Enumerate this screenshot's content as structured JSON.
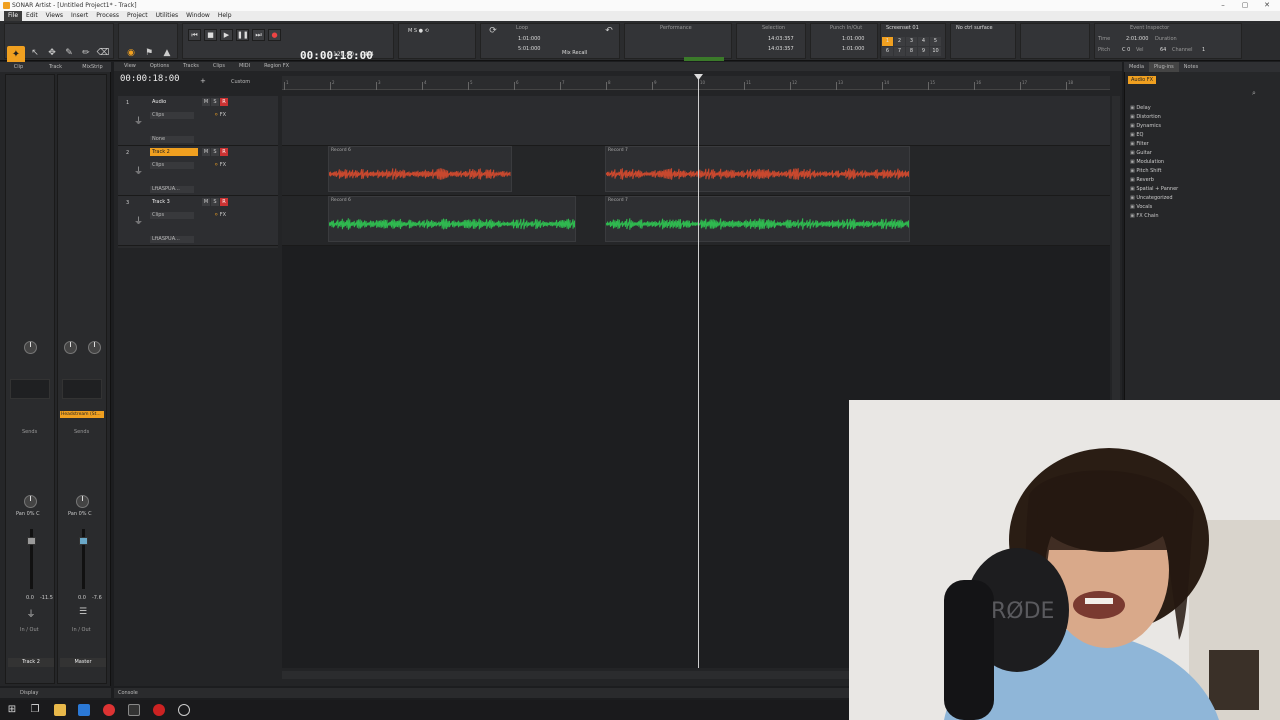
{
  "window": {
    "title": "SONAR Artist - [Untitled Project1* - Track]"
  },
  "menu": [
    "File",
    "Edit",
    "Views",
    "Insert",
    "Process",
    "Project",
    "Utilities",
    "Window",
    "Help"
  ],
  "control_bar": {
    "time": "00:00:18:00",
    "tempo": "120.00",
    "meter": "4/4",
    "loop_label": "Loop",
    "loop_start": "1:01:000",
    "loop_end": "5:01:000",
    "mix_recall": "Mix Recall",
    "performance_label": "Performance",
    "selection_label": "Selection",
    "selection_start": "14:03:357",
    "selection_end": "14:03:357",
    "punch_label": "Punch In/Out",
    "punch_start": "1:01:000",
    "punch_end": "1:01:000",
    "screenset_label": "Screenset 01",
    "screenset_nums": [
      "1",
      "2",
      "3",
      "4",
      "5",
      "6",
      "7",
      "8",
      "9",
      "10"
    ],
    "ctrl_surface": "No ctrl surface",
    "event_inspector": "Event Inspector",
    "ei_time": "Time",
    "ei_time_val": "2:01:000",
    "ei_duration": "Duration",
    "ei_pitch": "Pitch",
    "ei_pitch_val": "C 0",
    "ei_vel": "Vel",
    "ei_vel_val": "64",
    "ei_channel": "Channel",
    "ei_channel_val": "1"
  },
  "inspector": {
    "tabs": [
      "Clip",
      "Track",
      "MixStrip"
    ],
    "strip1": {
      "name": "Track 2",
      "pan": "Pan 0% C",
      "vol": "0.0",
      "peak": "-11.5",
      "io": "In / Out"
    },
    "strip2": {
      "name": "Master",
      "pan": "Pan 0% C",
      "vol": "0.0",
      "peak": "-7.6",
      "io": "In / Out"
    },
    "fx_slot": "Headstream (St...",
    "sends": "Sends",
    "display": "Display"
  },
  "trackview": {
    "menu": [
      "View",
      "Options",
      "Tracks",
      "Clips",
      "MIDI",
      "Region FX"
    ],
    "time": "00:00:18:00",
    "custom": "Custom",
    "ruler": [
      "1",
      "2",
      "3",
      "4",
      "5",
      "6",
      "7",
      "8",
      "9",
      "10",
      "11",
      "12",
      "13",
      "14",
      "15",
      "16",
      "17",
      "18"
    ],
    "tracks": [
      {
        "num": "1",
        "name": "Audio",
        "clips": "Clips",
        "fx": "FX",
        "input": "None",
        "selected": false
      },
      {
        "num": "2",
        "name": "Track 2",
        "clips": "Clips",
        "fx": "FX",
        "input": "LftASPUA...",
        "selected": true
      },
      {
        "num": "3",
        "name": "Track 3",
        "clips": "Clips",
        "fx": "FX",
        "input": "LftASPUA...",
        "selected": false
      }
    ],
    "msr": [
      "M",
      "S",
      "R"
    ],
    "clip_labels": {
      "t2a": "Record 6",
      "t2b": "Record 7",
      "t3a": "Record 6",
      "t3b": "Record 7"
    },
    "colors": {
      "track2_wave": "#c8482e",
      "track3_wave": "#2fb84f",
      "accent": "#f0a020"
    }
  },
  "browser": {
    "tabs": [
      "Media",
      "Plug-ins",
      "Notes"
    ],
    "subtab": "Audio FX",
    "items": [
      "Delay",
      "Distortion",
      "Dynamics",
      "EQ",
      "Filter",
      "Guitar",
      "Modulation",
      "Pitch Shift",
      "Reverb",
      "Spatial + Panner",
      "Uncategorized",
      "Vocals",
      "FX Chain"
    ]
  },
  "console": "Console"
}
